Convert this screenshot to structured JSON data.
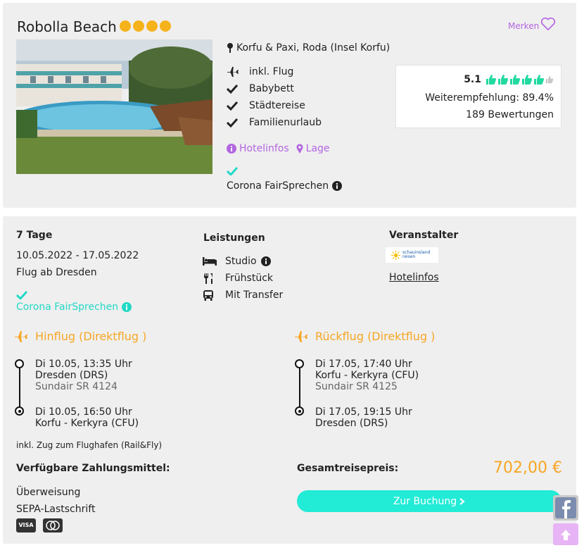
{
  "hotel": {
    "name": "Robolla Beach",
    "stars": 4,
    "merken_label": "Merken",
    "location": "Korfu & Paxi, Roda (Insel Korfu)",
    "features": [
      {
        "icon": "plane-icon",
        "label": "inkl. Flug"
      },
      {
        "icon": "check-icon",
        "label": "Babybett"
      },
      {
        "icon": "check-icon",
        "label": "Städtereise"
      },
      {
        "icon": "check-icon",
        "label": "Familienurlaub"
      }
    ],
    "links": {
      "hotelinfos": "Hotelinfos",
      "lage": "Lage"
    },
    "corona_label": "Corona FairSprechen"
  },
  "rating": {
    "score": "5.1",
    "thumbs_filled": 5,
    "thumbs_total": 6,
    "recommendation": "Weiterempfehlung: 89.4%",
    "reviews": "189 Bewertungen"
  },
  "offer": {
    "duration": "7 Tage",
    "dates": "10.05.2022 - 17.05.2022",
    "departure": "Flug ab Dresden",
    "corona_label": "Corona FairSprechen",
    "services_heading": "Leistungen",
    "services": [
      {
        "icon": "bed-icon",
        "label": "Studio"
      },
      {
        "icon": "cutlery-icon",
        "label": "Frühstück"
      },
      {
        "icon": "bus-icon",
        "label": "Mit Transfer"
      }
    ],
    "operator_heading": "Veranstalter",
    "operator_logo_text": "schauinsland reisen",
    "operator_link": "Hotelinfos"
  },
  "outbound": {
    "title": "Hinflug (Direktflug )",
    "dep_time": "Di 10.05, 13:35 Uhr",
    "dep_airport": "Dresden (DRS)",
    "flight": "Sundair SR 4124",
    "arr_time": "Di 10.05, 16:50 Uhr",
    "arr_airport": "Korfu - Kerkyra (CFU)"
  },
  "return": {
    "title": "Rückflug (Direktflug )",
    "dep_time": "Di 17.05, 17:40 Uhr",
    "dep_airport": "Korfu - Kerkyra (CFU)",
    "flight": "Sundair SR 4125",
    "arr_time": "Di 17.05, 19:15 Uhr",
    "arr_airport": "Dresden (DRS)"
  },
  "rail_note": "inkl. Zug zum Flughafen (Rail&Fly)",
  "payment": {
    "heading": "Verfügbare Zahlungsmittel:",
    "methods": [
      "Überweisung",
      "SEPA-Lastschrift"
    ],
    "cards": [
      "VISA",
      "mastercard"
    ]
  },
  "total": {
    "label": "Gesamtreisepreis:",
    "price": "702,00 €",
    "button": "Zur Buchung"
  },
  "colors": {
    "accent_orange": "#f6a623",
    "teal": "#22d9c6",
    "purple": "#b366e0",
    "button": "#22ebd6"
  }
}
